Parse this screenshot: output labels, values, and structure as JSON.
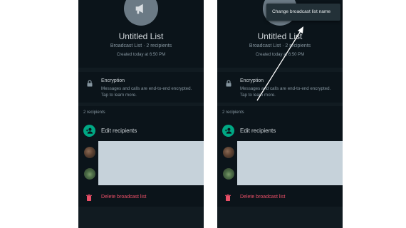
{
  "group": {
    "title": "Untitled List",
    "subtitle": "Broadcast List · 2 recipients",
    "created": "Created today at 6:50 PM"
  },
  "encryption": {
    "title": "Encryption",
    "text": "Messages and calls are end-to-end encrypted. Tap to learn more."
  },
  "recipients": {
    "count_label": "2 recipients",
    "edit_label": "Edit recipients"
  },
  "delete_label": "Delete broadcast list",
  "menu": {
    "item": "Change broadcast list name"
  },
  "colors": {
    "accent": "#00a884",
    "danger": "#ea4f67",
    "background": "#111b21"
  }
}
